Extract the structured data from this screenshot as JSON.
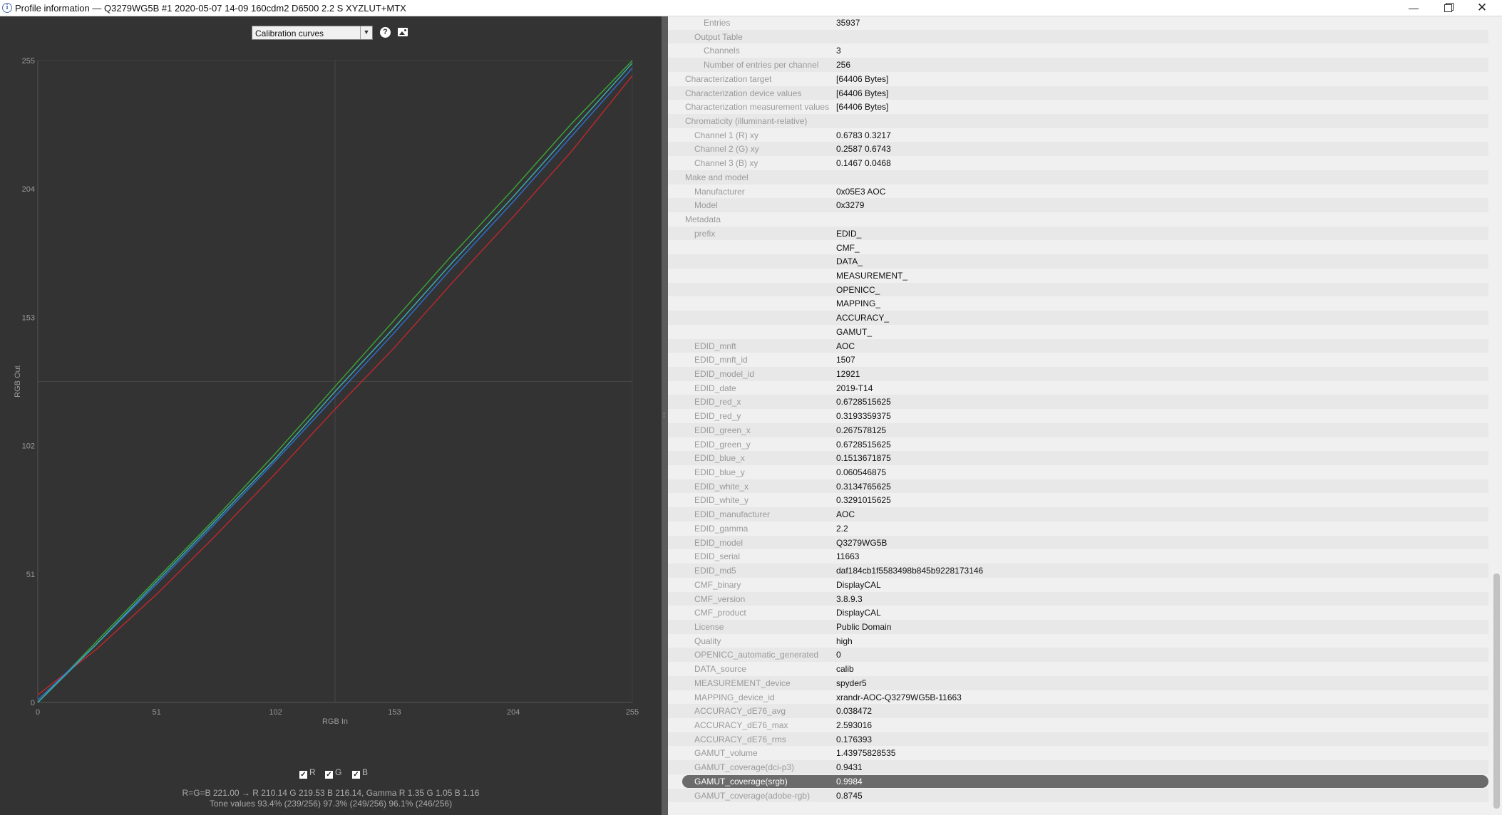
{
  "window": {
    "title": "Profile information — Q3279WG5B #1 2020-05-07 14-09 160cdm2 D6500 2.2 S XYZLUT+MTX",
    "minimize_label": "—",
    "close_label": "✕"
  },
  "toolbar": {
    "selected_view": "Calibration curves",
    "help_icon": "?"
  },
  "chart_data": {
    "type": "line",
    "xlabel": "RGB In",
    "ylabel": "RGB Out",
    "xlim": [
      0,
      255
    ],
    "ylim": [
      0,
      255
    ],
    "xticks": [
      0,
      51,
      102,
      153,
      204,
      255
    ],
    "yticks": [
      0,
      51,
      102,
      153,
      204,
      255
    ],
    "grid": "center crosshair",
    "background": "#333333",
    "series": [
      {
        "name": "R",
        "color": "#c0272d",
        "x": [
          0,
          25,
          51,
          76,
          102,
          127,
          153,
          178,
          204,
          229,
          255
        ],
        "y": [
          3,
          21,
          43,
          66,
          91,
          116,
          141,
          167,
          193,
          219,
          249
        ]
      },
      {
        "name": "G",
        "color": "#3aa935",
        "x": [
          0,
          25,
          51,
          76,
          102,
          127,
          153,
          178,
          204,
          229,
          255
        ],
        "y": [
          0,
          24,
          49,
          73,
          99,
          125,
          152,
          178,
          204,
          230,
          255
        ]
      },
      {
        "name": "B",
        "color": "#2f6fd0",
        "x": [
          0,
          25,
          51,
          76,
          102,
          127,
          153,
          178,
          204,
          229,
          255
        ],
        "y": [
          1,
          23,
          47,
          71,
          96,
          121,
          147,
          173,
          199,
          225,
          252
        ]
      },
      {
        "name": "",
        "color": "#3bb0b0",
        "x": [
          0,
          25,
          51,
          76,
          102,
          127,
          153,
          178,
          204,
          229,
          255
        ],
        "y": [
          0,
          23,
          48,
          72,
          97,
          123,
          149,
          175,
          201,
          227,
          254
        ]
      }
    ]
  },
  "legend": [
    {
      "label": "R",
      "checked": "✓"
    },
    {
      "label": "G",
      "checked": "✓"
    },
    {
      "label": "B",
      "checked": "✓"
    }
  ],
  "info": {
    "line1": "R=G=B 221.00 → R 210.14 G 219.53 B 216.14, Gamma R 1.35 G 1.05 B 1.16",
    "line2": "Tone values 93.4% (239/256) 97.3% (249/256) 96.1% (246/256)"
  },
  "details": [
    {
      "key": "Entries",
      "value": "35937",
      "indent": 2
    },
    {
      "key": "Output Table",
      "value": "",
      "indent": 1
    },
    {
      "key": "Channels",
      "value": "3",
      "indent": 2
    },
    {
      "key": "Number of entries per channel",
      "value": "256",
      "indent": 2
    },
    {
      "key": "Characterization target",
      "value": "[64406 Bytes]",
      "indent": 0
    },
    {
      "key": "Characterization device values",
      "value": "[64406 Bytes]",
      "indent": 0
    },
    {
      "key": "Characterization measurement values",
      "value": "[64406 Bytes]",
      "indent": 0
    },
    {
      "key": "Chromaticity (illuminant-relative)",
      "value": "",
      "indent": 0
    },
    {
      "key": "Channel 1 (R) xy",
      "value": "0.6783 0.3217",
      "indent": 1
    },
    {
      "key": "Channel 2 (G) xy",
      "value": "0.2587 0.6743",
      "indent": 1
    },
    {
      "key": "Channel 3 (B) xy",
      "value": "0.1467 0.0468",
      "indent": 1
    },
    {
      "key": "Make and model",
      "value": "",
      "indent": 0
    },
    {
      "key": "Manufacturer",
      "value": "0x05E3 AOC",
      "indent": 1
    },
    {
      "key": "Model",
      "value": "0x3279",
      "indent": 1
    },
    {
      "key": "Metadata",
      "value": "",
      "indent": 0
    },
    {
      "key": "prefix",
      "value": "EDID_",
      "indent": 1
    },
    {
      "key": "",
      "value": "CMF_",
      "indent": 1
    },
    {
      "key": "",
      "value": "DATA_",
      "indent": 1
    },
    {
      "key": "",
      "value": "MEASUREMENT_",
      "indent": 1
    },
    {
      "key": "",
      "value": "OPENICC_",
      "indent": 1
    },
    {
      "key": "",
      "value": "MAPPING_",
      "indent": 1
    },
    {
      "key": "",
      "value": "ACCURACY_",
      "indent": 1
    },
    {
      "key": "",
      "value": "GAMUT_",
      "indent": 1
    },
    {
      "key": "EDID_mnft",
      "value": "AOC",
      "indent": 1
    },
    {
      "key": "EDID_mnft_id",
      "value": "1507",
      "indent": 1
    },
    {
      "key": "EDID_model_id",
      "value": "12921",
      "indent": 1
    },
    {
      "key": "EDID_date",
      "value": "2019-T14",
      "indent": 1
    },
    {
      "key": "EDID_red_x",
      "value": "0.6728515625",
      "indent": 1
    },
    {
      "key": "EDID_red_y",
      "value": "0.3193359375",
      "indent": 1
    },
    {
      "key": "EDID_green_x",
      "value": "0.267578125",
      "indent": 1
    },
    {
      "key": "EDID_green_y",
      "value": "0.6728515625",
      "indent": 1
    },
    {
      "key": "EDID_blue_x",
      "value": "0.1513671875",
      "indent": 1
    },
    {
      "key": "EDID_blue_y",
      "value": "0.060546875",
      "indent": 1
    },
    {
      "key": "EDID_white_x",
      "value": "0.3134765625",
      "indent": 1
    },
    {
      "key": "EDID_white_y",
      "value": "0.3291015625",
      "indent": 1
    },
    {
      "key": "EDID_manufacturer",
      "value": "AOC",
      "indent": 1
    },
    {
      "key": "EDID_gamma",
      "value": "2.2",
      "indent": 1
    },
    {
      "key": "EDID_model",
      "value": "Q3279WG5B",
      "indent": 1
    },
    {
      "key": "EDID_serial",
      "value": "11663",
      "indent": 1
    },
    {
      "key": "EDID_md5",
      "value": "daf184cb1f5583498b845b9228173146",
      "indent": 1
    },
    {
      "key": "CMF_binary",
      "value": "DisplayCAL",
      "indent": 1
    },
    {
      "key": "CMF_version",
      "value": "3.8.9.3",
      "indent": 1
    },
    {
      "key": "CMF_product",
      "value": "DisplayCAL",
      "indent": 1
    },
    {
      "key": "License",
      "value": "Public Domain",
      "indent": 1
    },
    {
      "key": "Quality",
      "value": "high",
      "indent": 1
    },
    {
      "key": "OPENICC_automatic_generated",
      "value": "0",
      "indent": 1
    },
    {
      "key": "DATA_source",
      "value": "calib",
      "indent": 1
    },
    {
      "key": "MEASUREMENT_device",
      "value": "spyder5",
      "indent": 1
    },
    {
      "key": "MAPPING_device_id",
      "value": "xrandr-AOC-Q3279WG5B-11663",
      "indent": 1
    },
    {
      "key": "ACCURACY_dE76_avg",
      "value": "0.038472",
      "indent": 1
    },
    {
      "key": "ACCURACY_dE76_max",
      "value": "2.593016",
      "indent": 1
    },
    {
      "key": "ACCURACY_dE76_rms",
      "value": "0.176393",
      "indent": 1
    },
    {
      "key": "GAMUT_volume",
      "value": "1.43975828535",
      "indent": 1
    },
    {
      "key": "GAMUT_coverage(dci-p3)",
      "value": "0.9431",
      "indent": 1
    },
    {
      "key": "GAMUT_coverage(srgb)",
      "value": "0.9984",
      "indent": 1,
      "selected": true
    },
    {
      "key": "GAMUT_coverage(adobe-rgb)",
      "value": "0.8745",
      "indent": 1
    }
  ]
}
